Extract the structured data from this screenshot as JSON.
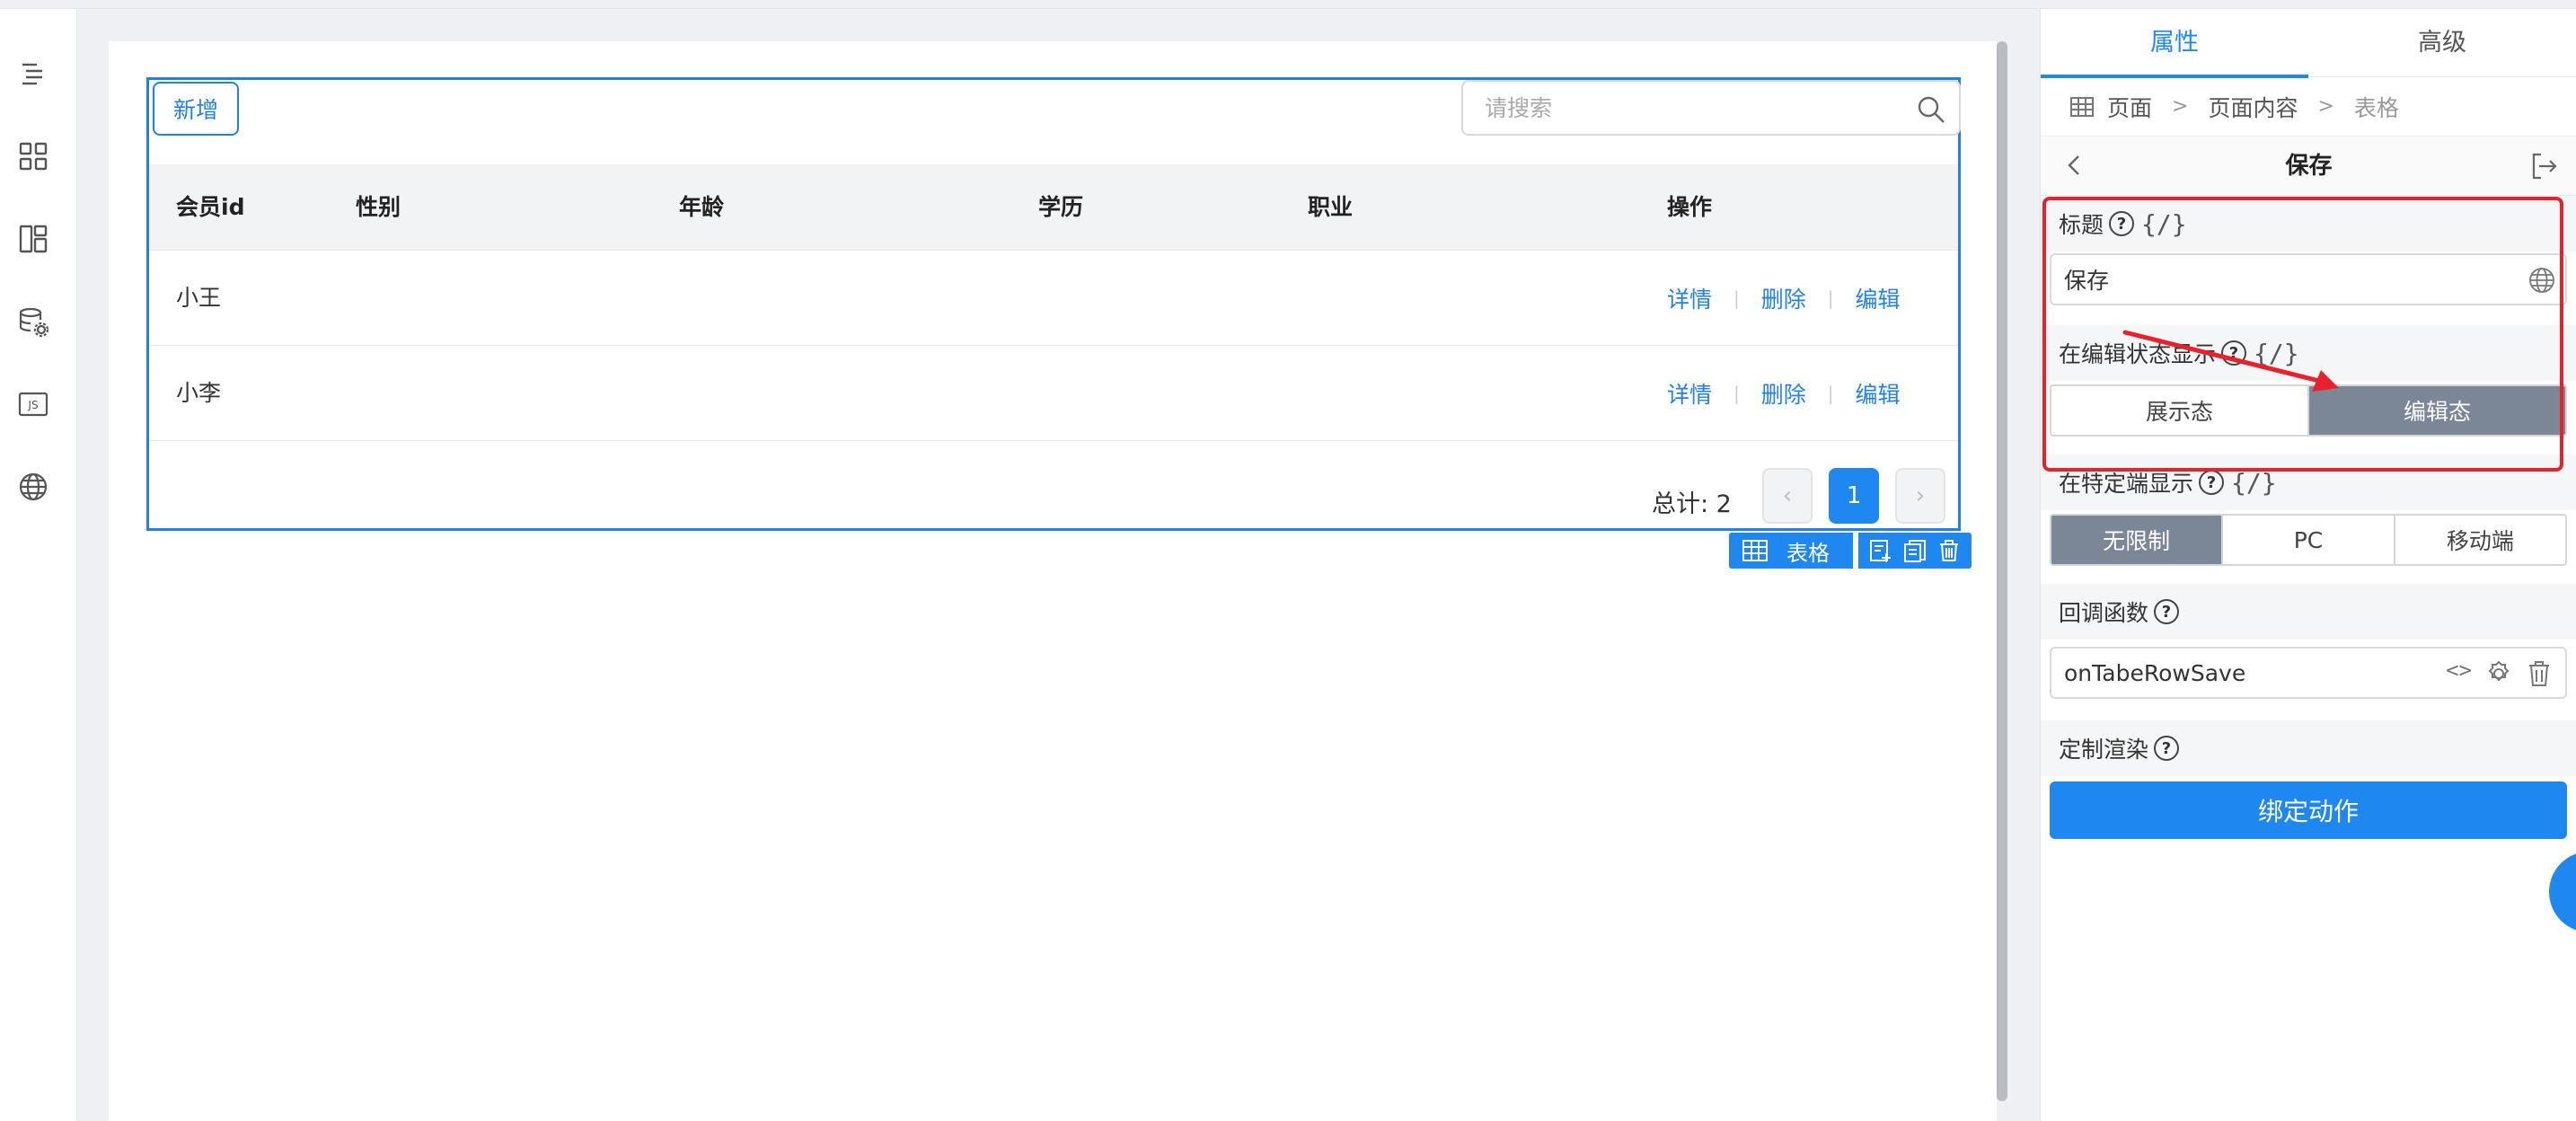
{
  "sidebar": {
    "tools": [
      {
        "icon": "outline-tree-icon"
      },
      {
        "icon": "components-grid-icon"
      },
      {
        "icon": "layout-icon"
      },
      {
        "icon": "datasource-settings-icon"
      },
      {
        "icon": "js-code-icon",
        "text": "JS"
      },
      {
        "icon": "globe-icon"
      }
    ]
  },
  "table": {
    "add_label": "新增",
    "search_placeholder": "请搜索",
    "columns": [
      "会员id",
      "性别",
      "年龄",
      "学历",
      "职业",
      "操作"
    ],
    "rows": [
      {
        "member_id": "小王",
        "actions": [
          "详情",
          "删除",
          "编辑"
        ]
      },
      {
        "member_id": "小李",
        "actions": [
          "详情",
          "删除",
          "编辑"
        ]
      }
    ],
    "total_label": "总计: 2",
    "pagination": {
      "current": "1",
      "prev": "‹",
      "next": "›"
    },
    "tag_label": "表格"
  },
  "panel": {
    "tabs": [
      "属性",
      "高级"
    ],
    "active_tab": 0,
    "breadcrumb": [
      "页面",
      "页面内容",
      "表格"
    ],
    "title": "保存",
    "title_field": {
      "label": "标题",
      "expr": "{/}",
      "value": "保存"
    },
    "edit_state_display": {
      "label": "在编辑状态显示",
      "expr": "{/}",
      "options": [
        "展示态",
        "编辑态"
      ],
      "selected": 1
    },
    "terminal_display": {
      "label": "在特定端显示",
      "expr": "{/}",
      "options": [
        "无限制",
        "PC",
        "移动端"
      ],
      "selected": 0
    },
    "callback": {
      "label": "回调函数",
      "value": "onTabeRowSave"
    },
    "custom_render": {
      "label": "定制渲染"
    },
    "bind_action_label": "绑定动作"
  },
  "colors": {
    "accent": "#1e88f0",
    "selection": "#2281e8",
    "segment_active": "#7b8797",
    "annotation": "#e8222c"
  }
}
